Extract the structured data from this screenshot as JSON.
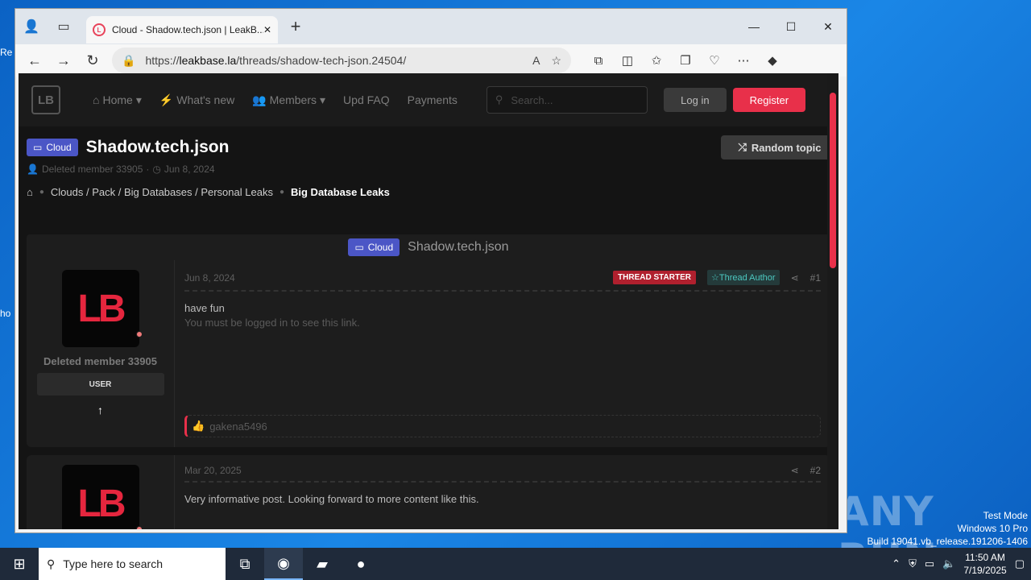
{
  "desktop": {
    "edge_texts": [
      "Re",
      "ho"
    ]
  },
  "watermark": {
    "line1": "Test Mode",
    "line2": "Windows 10 Pro",
    "line3": "Build 19041.vb_release.191206-1406",
    "brand": "ANY RUN"
  },
  "browser": {
    "tab_title": "Cloud - Shadow.tech.json | LeakB...",
    "url_prefix": "https://",
    "url_host": "leakbase.la",
    "url_path": "/threads/shadow-tech-json.24504/"
  },
  "site": {
    "logo": "LB",
    "nav": [
      "Home",
      "What's new",
      "Members",
      "Upd FAQ",
      "Payments"
    ],
    "search_placeholder": "Search...",
    "login": "Log in",
    "register": "Register"
  },
  "thread": {
    "prefix": "Cloud",
    "title": "Shadow.tech.json",
    "random_topic": "Random topic",
    "author": "Deleted member 33905",
    "date": "Jun 8, 2024",
    "crumbs": [
      "Clouds / Pack / Big Databases / Personal Leaks",
      "Big Database Leaks"
    ]
  },
  "posts": [
    {
      "username": "Deleted member 33905",
      "role": "USER",
      "date": "Jun 8, 2024",
      "badge_starter": "THREAD STARTER",
      "badge_author": "Thread Author",
      "number": "#1",
      "text": "have fun",
      "link_notice": "You must be logged in to see this link.",
      "reaction_user": "gakena5496"
    },
    {
      "date": "Mar 20, 2025",
      "number": "#2",
      "text": "Very informative post. Looking forward to more content like this."
    }
  ],
  "taskbar": {
    "search_placeholder": "Type here to search",
    "time": "11:50 AM",
    "date": "7/19/2025"
  }
}
